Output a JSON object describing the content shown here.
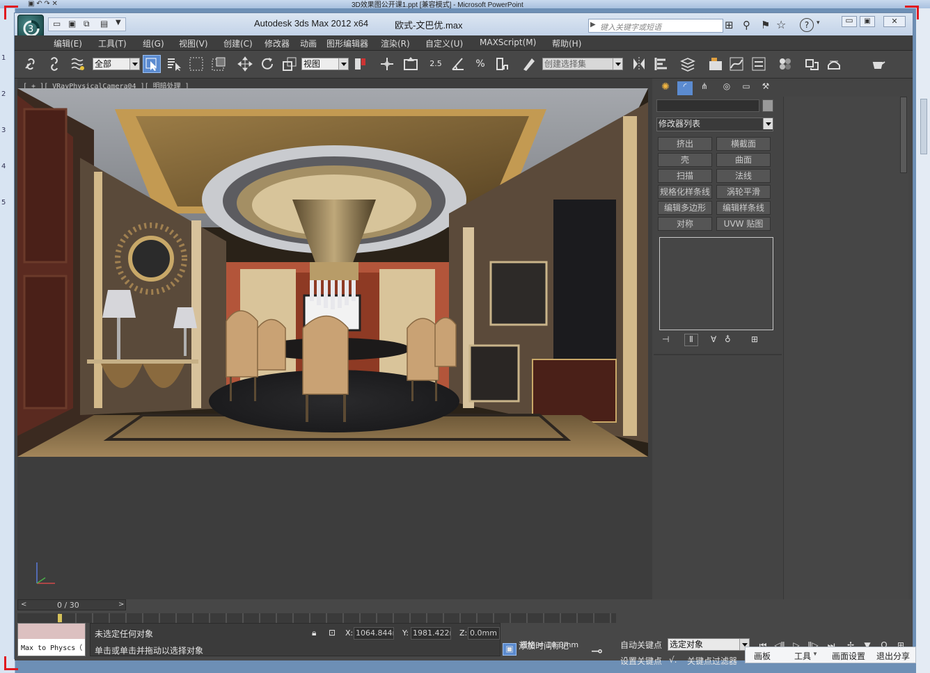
{
  "ppt": {
    "title": "3D效果图公开课1.ppt [兼容模式] - Microsoft PowerPoint",
    "slide_numbers": [
      "1",
      "2",
      "3",
      "4",
      "5"
    ]
  },
  "titlebar": {
    "app": "Autodesk 3ds Max  2012 x64",
    "file": "欧式-文巴优.max",
    "search_placeholder": "键入关键字或短语"
  },
  "menu": [
    "编辑(E)",
    "工具(T)",
    "组(G)",
    "视图(V)",
    "创建(C)",
    "修改器",
    "动画",
    "图形编辑器",
    "渲染(R)",
    "自定义(U)",
    "MAXScript(M)",
    "帮助(H)"
  ],
  "toolbar": {
    "filter": "全部",
    "ref_coord": "视图",
    "snap_25": "2.5",
    "selection_set_placeholder": "创建选择集"
  },
  "viewport": {
    "label": "[ + ][ VRayPhysicalCamera04 ][ 明暗处理 ]"
  },
  "command_panel": {
    "modifier_list": "修改器列表",
    "modifiers": [
      "挤出",
      "横截面",
      "壳",
      "曲面",
      "扫描",
      "法线",
      "规格化样条线",
      "涡轮平滑",
      "编辑多边形",
      "编辑样条线",
      "对称",
      "UVW 贴图"
    ]
  },
  "timeline": {
    "frame": "0 / 30"
  },
  "status": {
    "left_field": "Max to Physcs（",
    "line1": "未选定任何对象",
    "line2": "单击或单击并拖动以选择对象",
    "x_label": "X:",
    "x_value": "1064.844m",
    "y_label": "Y:",
    "y_value": "1981.422m",
    "z_label": "Z:",
    "z_value": "0.0mm",
    "grid": "栅格 = 10.0mm",
    "add_time_tag": "添加时间标记",
    "auto_key": "自动关键点",
    "set_key": "设置关键点",
    "selected_dropdown": "选定对象",
    "key_filters": "关键点过滤器"
  },
  "sharebar": [
    "画板",
    "工具",
    "画面设置",
    "退出分享"
  ],
  "colors": {
    "accent_red": "#e0191f",
    "max_bg": "#444444",
    "title_bg": "#c3d3e8"
  }
}
